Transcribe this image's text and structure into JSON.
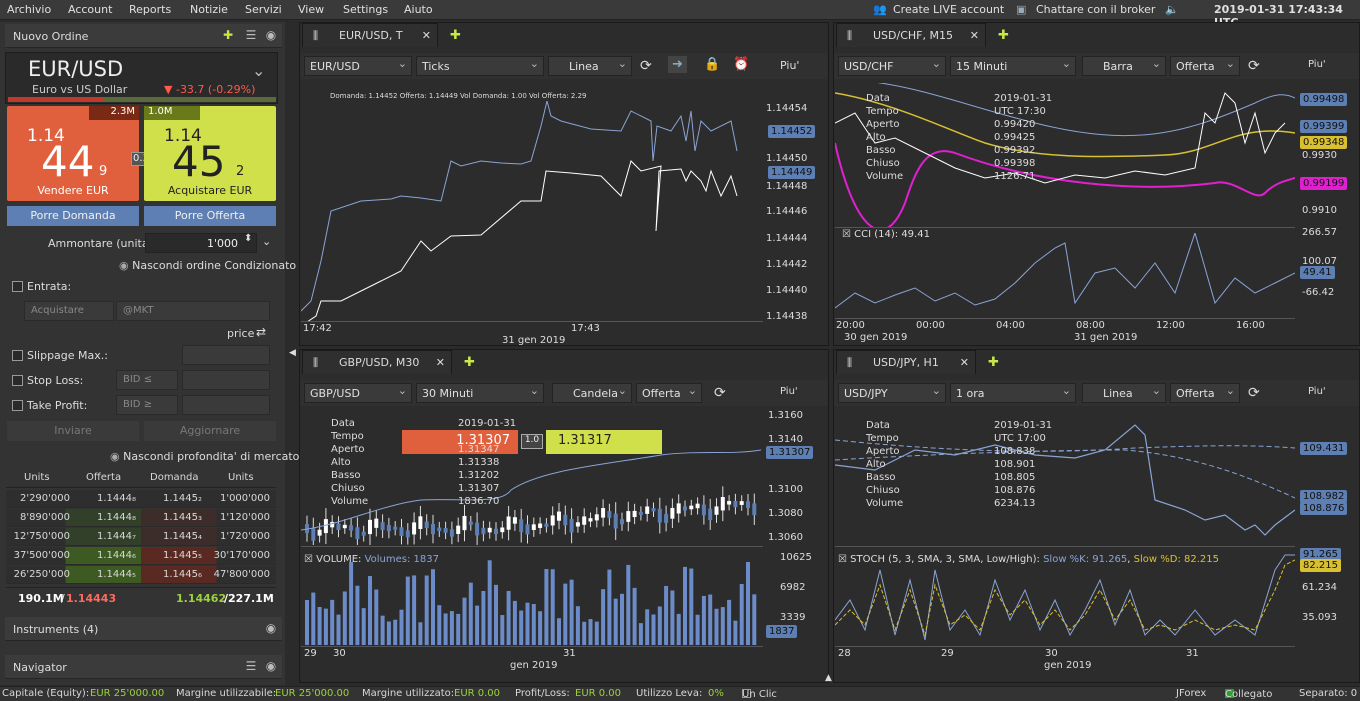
{
  "menubar": {
    "items": [
      "Archivio",
      "Account",
      "Reports",
      "Notizie",
      "Servizi",
      "View",
      "Settings",
      "Aiuto"
    ],
    "create_live": "Create LIVE account",
    "chat": "Chattare con il broker",
    "datetime": "2019-01-31  17:43:34  UTC"
  },
  "order": {
    "title": "Nuovo Ordine",
    "symbol": "EUR/USD",
    "desc": "Euro vs US Dollar",
    "change": "-33.7 (-0.29%)",
    "sell": {
      "vol": "2.3M",
      "big_prefix": "1.14",
      "big": "44",
      "pip": "9",
      "label": "Vendere EUR"
    },
    "spread": "0.3",
    "buy": {
      "vol": "1.0M",
      "big_prefix": "1.14",
      "big": "45",
      "pip": "2",
      "label": "Acquistare EUR"
    },
    "bid_button": "Porre Domanda",
    "offer_button": "Porre Offerta",
    "amount_label": "Ammontare (unita')",
    "amount": "1'000",
    "hide_conditional": "Nascondi ordine Condizionato",
    "entry_label": "Entrata:",
    "entry_field": "Acquistare",
    "entry_mkt": "@MKT",
    "price_label": "price",
    "slippage": "Slippage Max.:",
    "stoploss": "Stop Loss:",
    "takeprofit": "Take Profit:",
    "bid_le": "BID ≤",
    "bid_ge": "BID ≥",
    "send": "Inviare",
    "update": "Aggiornare",
    "hide_depth": "Nascondi profondita' di mercato"
  },
  "depth": {
    "headers": [
      "Units",
      "Offerta",
      "Domanda",
      "Units"
    ],
    "rows": [
      [
        "2'290'000",
        "1.1444₈",
        "1.1445₂",
        "1'000'000"
      ],
      [
        "8'890'000",
        "1.1444₈",
        "1.1445₃",
        "1'120'000"
      ],
      [
        "12'750'000",
        "1.1444₇",
        "1.1445₄",
        "1'720'000"
      ],
      [
        "37'500'000",
        "1.1444₆",
        "1.1445₅",
        "30'170'000"
      ],
      [
        "26'250'000",
        "1.1444₅",
        "1.1445₆",
        "47'800'000"
      ]
    ],
    "tot_left": "190.1M",
    "tot_left_price": "1.14443",
    "tot_right_price": "1.14462",
    "tot_right": "227.1M"
  },
  "instruments": "Instruments (4)",
  "navigator": "Navigator",
  "charts": {
    "c1": {
      "tab": "EUR/USD, T",
      "inst": "EUR/USD",
      "period": "Ticks",
      "type": "Linea",
      "more": "Piu'",
      "info": "Domanda: 1.14452  Offerta: 1.14449  Vol Domanda: 1.00  Vol Offerta: 2.29",
      "yticks": [
        "1.14454",
        "1.14452",
        "1.14450",
        "1.14449",
        "1.14448",
        "1.14446",
        "1.14444",
        "1.14442",
        "1.14440",
        "1.14438"
      ],
      "tag_ask": "1.14452",
      "tag_bid": "1.14449",
      "xticks": [
        "17:42",
        "17:43"
      ],
      "xdate": "31 gen 2019"
    },
    "c2": {
      "tab": "USD/CHF, M15",
      "inst": "USD/CHF",
      "period": "15 Minuti",
      "type": "Barra",
      "side": "Offerta",
      "more": "Piu'",
      "legend_keys": [
        "Data",
        "Tempo",
        "Aperto",
        "Alto",
        "Basso",
        "Chiuso",
        "Volume"
      ],
      "legend_vals": [
        "2019-01-31",
        "UTC 17:30",
        "0.99420",
        "0.99425",
        "0.99392",
        "0.99398",
        "1126.71"
      ],
      "yticks": [
        "0.99498",
        "0.99399",
        "0.99348",
        "0.9930",
        "0.99199",
        "0.9910"
      ],
      "cci": "CCI (14): 49.41",
      "cci_ticks": [
        "266.57",
        "100.07",
        "49.41",
        "-66.42"
      ],
      "xticks": [
        "20:00",
        "00:00",
        "04:00",
        "08:00",
        "12:00",
        "16:00"
      ],
      "xdates": [
        "30 gen 2019",
        "31 gen 2019"
      ]
    },
    "c3": {
      "tab": "GBP/USD, M30",
      "inst": "GBP/USD",
      "period": "30 Minuti",
      "type": "Candela",
      "side": "Offerta",
      "more": "Piu'",
      "legend_keys": [
        "Data",
        "Tempo",
        "Aperto",
        "Alto",
        "Basso",
        "Chiuso",
        "Volume"
      ],
      "legend_vals": [
        "2019-01-31",
        "",
        "1.31347",
        "1.31338",
        "1.31202",
        "1.31307",
        "1836.70"
      ],
      "sell_px": "1.31307",
      "spread": "1.0",
      "buy_px": "1.31317",
      "yticks": [
        "1.3160",
        "1.3140",
        "1.31307",
        "1.3100",
        "1.3080",
        "1.3060"
      ],
      "vol_label": "VOLUME:",
      "vol_val": "Volumes: 1837",
      "vol_ticks": [
        "10625",
        "6982",
        "3339",
        "1837"
      ],
      "xticks": [
        "29",
        "30",
        "31"
      ],
      "xdate": "gen 2019"
    },
    "c4": {
      "tab": "USD/JPY, H1",
      "inst": "USD/JPY",
      "period": "1 ora",
      "type": "Linea",
      "side": "Offerta",
      "more": "Piu'",
      "legend_keys": [
        "Data",
        "Tempo",
        "Aperto",
        "Alto",
        "Basso",
        "Chiuso",
        "Volume"
      ],
      "legend_vals": [
        "2019-01-31",
        "UTC 17:00",
        "108.838",
        "108.901",
        "108.805",
        "108.876",
        "6234.13"
      ],
      "yticks": [
        "109.431",
        "108.982",
        "108.876"
      ],
      "stoch": "STOCH (5, 3, SMA, 3, SMA, Low/High):",
      "stoch_k": "Slow %K: 91.265",
      "stoch_d": "Slow %D: 82.215",
      "stoch_ticks": [
        "91.265",
        "82.215",
        "61.234",
        "35.093"
      ],
      "xticks": [
        "28",
        "29",
        "30",
        "31"
      ],
      "xdate": "gen 2019"
    }
  },
  "status": {
    "equity_l": "Capitale (Equity):",
    "equity": "EUR 25'000.00",
    "margin_l": "Margine utilizzabile:",
    "margin": "EUR 25'000.00",
    "used_l": "Margine utilizzato:",
    "used": "EUR 0.00",
    "pl_l": "Profit/Loss:",
    "pl": "EUR 0.00",
    "lev_l": "Utilizzo Leva:",
    "lev": "0%",
    "oneclick": "Un Clic",
    "brand": "JForex",
    "conn": "Collegato",
    "sep": "Separato: 0"
  }
}
